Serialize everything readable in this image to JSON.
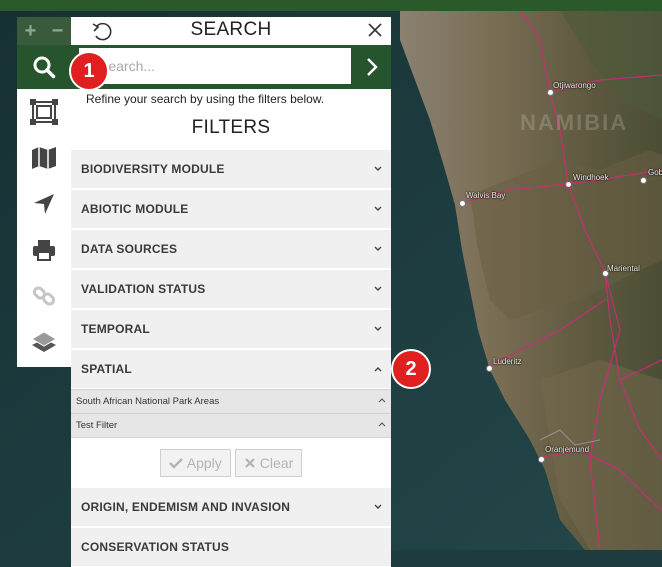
{
  "panel": {
    "title": "SEARCH",
    "search_placeholder": "Search...",
    "hint": "Refine your search by using the filters below.",
    "filters_title": "FILTERS",
    "sections": [
      {
        "label": "BIODIVERSITY MODULE"
      },
      {
        "label": "ABIOTIC MODULE"
      },
      {
        "label": "DATA SOURCES"
      },
      {
        "label": "VALIDATION STATUS"
      },
      {
        "label": "TEMPORAL"
      },
      {
        "label": "SPATIAL"
      }
    ],
    "spatial_sub": [
      {
        "label": "South African National Park Areas"
      },
      {
        "label": "Test Filter"
      }
    ],
    "apply_label": "Apply",
    "clear_label": "Clear",
    "sections_after": [
      {
        "label": "ORIGIN, ENDEMISM AND INVASION"
      },
      {
        "label": "CONSERVATION STATUS"
      }
    ]
  },
  "toolbar": {
    "zoom_in": "+",
    "zoom_out": "−",
    "icons": [
      "search-icon",
      "select-area-icon",
      "map-icon",
      "location-arrow-icon",
      "print-icon",
      "link-icon",
      "layers-icon"
    ]
  },
  "map": {
    "country_label": "NAMIBIA",
    "cities": [
      "Otjiwarongo",
      "Windhoek",
      "Gob",
      "Walvis Bay",
      "Mariental",
      "Luderitz",
      "Oranjemund"
    ]
  },
  "callouts": [
    "1",
    "2"
  ],
  "colors": {
    "brand_green": "#26542c",
    "callout_red": "#e02020",
    "road_pink": "#d02a7a"
  }
}
